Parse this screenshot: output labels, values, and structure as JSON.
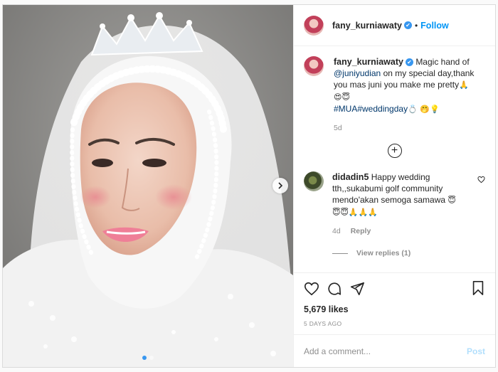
{
  "post": {
    "author": "fany_kurniawaty",
    "follow_label": "Follow",
    "verified_mark": "✔",
    "caption": {
      "author": "fany_kurniawaty",
      "text_before_mention": "Magic hand of",
      "mention": "@juniyudian",
      "text_after_mention": "on my special day,thank you mas juni you make me pretty",
      "emoji_line1": "🙏",
      "emoji_line2": "😍😇",
      "hashtags": "#MUA#weddingday",
      "emoji_line3": "💍 🤭💡",
      "age": "5d"
    },
    "load_more_icon": "plus-circle-icon",
    "comments": [
      {
        "author": "didadin5",
        "text": "Happy wedding tth,,sukabumi golf community mendo'akan semoga samawa",
        "emojis": "😇",
        "emojis_line2": "😇😇🙏🙏🙏",
        "age": "4d",
        "reply_label": "Reply",
        "view_replies": "View replies (1)"
      }
    ],
    "likes": "5,679 likes",
    "date": "5 DAYS AGO",
    "add_comment_placeholder": "Add a comment...",
    "post_button": "Post"
  },
  "colors": {
    "accent": "#0095f6",
    "link": "#00376b",
    "muted": "#8e8e8e",
    "post_disabled": "#b2dffc"
  },
  "icons": [
    "heart-icon",
    "comment-icon",
    "share-icon",
    "bookmark-icon",
    "next-arrow-icon",
    "verified-badge-icon"
  ]
}
